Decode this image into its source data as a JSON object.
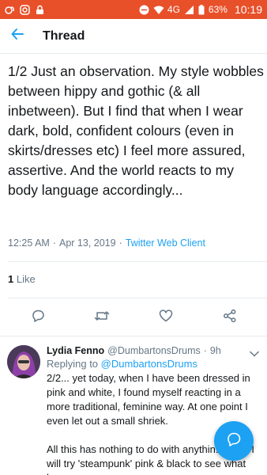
{
  "status_bar": {
    "battery": "63%",
    "network": "4G",
    "time": "10:19"
  },
  "header": {
    "title": "Thread"
  },
  "tweet": {
    "text": "1/2 Just an observation. My style wobbles between hippy and gothic (& all inbetween).  But I find that when I wear dark, bold, confident colours (even in skirts/dresses etc) I feel more assured, assertive. And the world reacts to my body language accordingly...",
    "time": "12:25 AM",
    "date": "Apr 13, 2019",
    "client": "Twitter Web Client",
    "likes_count": "1",
    "likes_label": "Like"
  },
  "reply": {
    "name": "Lydia Fenno",
    "handle": "@DumbartonsDrums",
    "age": "9h",
    "replying_label": "Replying to",
    "replying_to": "@DumbartonsDrums",
    "text": "2/2... yet today, when I have been dressed in pink and white, I found myself reacting in a more traditional, feminine way. At one point I even let out a small shriek.\n\nAll this has nothing to do with anythin... think I will try 'steampunk' pink & black to see what h..."
  },
  "colors": {
    "accent": "#1da1f2",
    "status_bar": "#e8502a",
    "secondary_text": "#657786"
  }
}
